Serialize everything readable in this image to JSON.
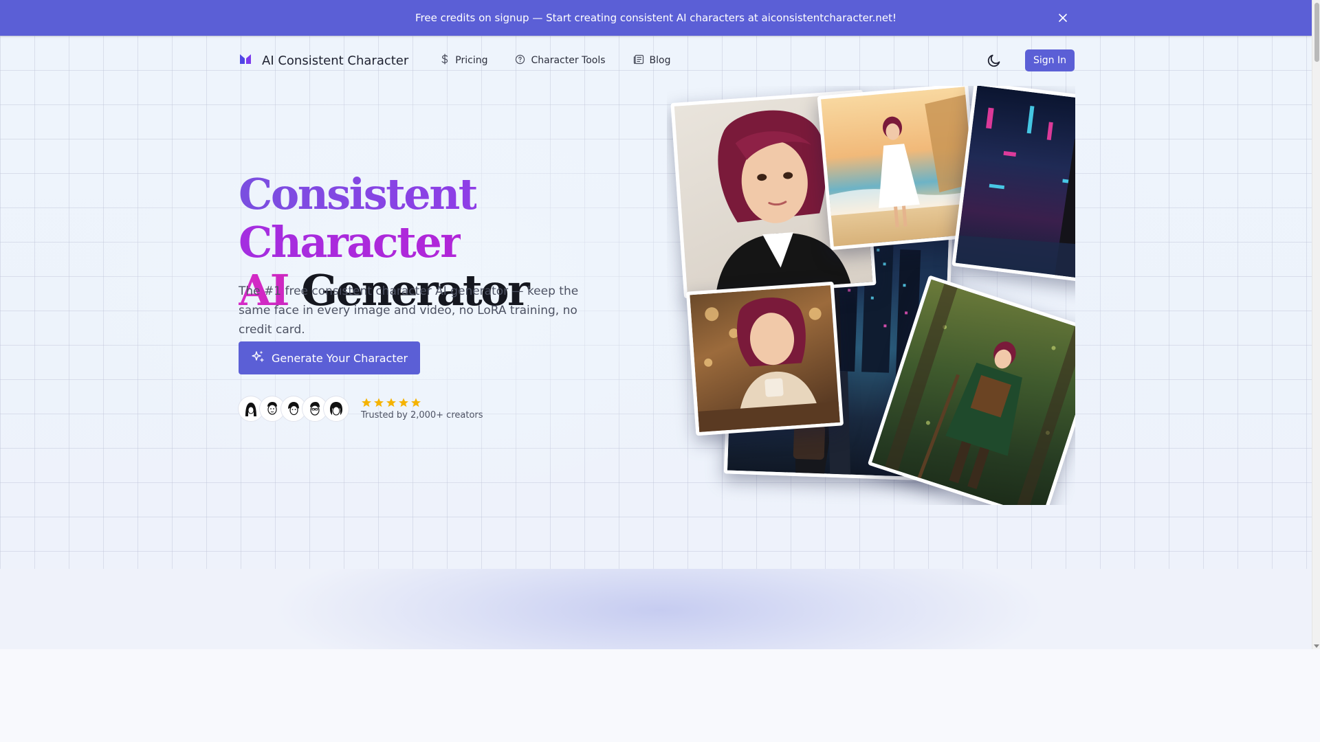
{
  "banner": {
    "text": "Free credits on signup — Start creating consistent AI characters at aiconsistentcharacter.net!",
    "close_icon": "close-icon"
  },
  "nav": {
    "brand_name": "AI Consistent Character",
    "links": [
      {
        "label": "Pricing",
        "icon": "dollar-icon"
      },
      {
        "label": "Character Tools",
        "icon": "help-circle-icon"
      },
      {
        "label": "Blog",
        "icon": "newspaper-icon"
      }
    ],
    "theme_icon": "moon-icon",
    "signin_label": "Sign In"
  },
  "hero": {
    "headline_word1": "Consistent",
    "headline_word2": "Character",
    "headline_word3": "AI",
    "headline_word4": "Generator",
    "subtitle": "The #1 free consistent character AI generator — keep the same face in every image and video, no LoRA training, no credit card.",
    "cta_label": "Generate Your Character",
    "cta_icon": "sparkles-icon",
    "rating_stars": 5,
    "trusted_text": "Trusted by 2,000+ creators"
  },
  "colors": {
    "accent": "#5b5fd6",
    "gradient_purple": "#7a4fe0",
    "gradient_magenta": "#d62ac7",
    "star": "#f5b301"
  }
}
